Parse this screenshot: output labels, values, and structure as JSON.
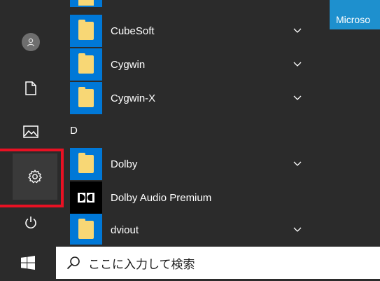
{
  "live_tile": {
    "label": "Microso"
  },
  "apps": {
    "cubesoft": "CubeSoft",
    "cygwin": "Cygwin",
    "cygwin_x": "Cygwin-X",
    "section_d": "D",
    "dolby": "Dolby",
    "dolby_audio": "Dolby Audio Premium",
    "dviout": "dviout"
  },
  "taskbar": {
    "search_placeholder": "ここに入力して検索"
  },
  "rail": {
    "icons": [
      "user-icon",
      "document-icon",
      "pictures-icon",
      "settings-icon",
      "power-icon"
    ]
  },
  "colors": {
    "accent": "#0078d7",
    "highlight": "#e81123",
    "folder": "#f8d775"
  }
}
